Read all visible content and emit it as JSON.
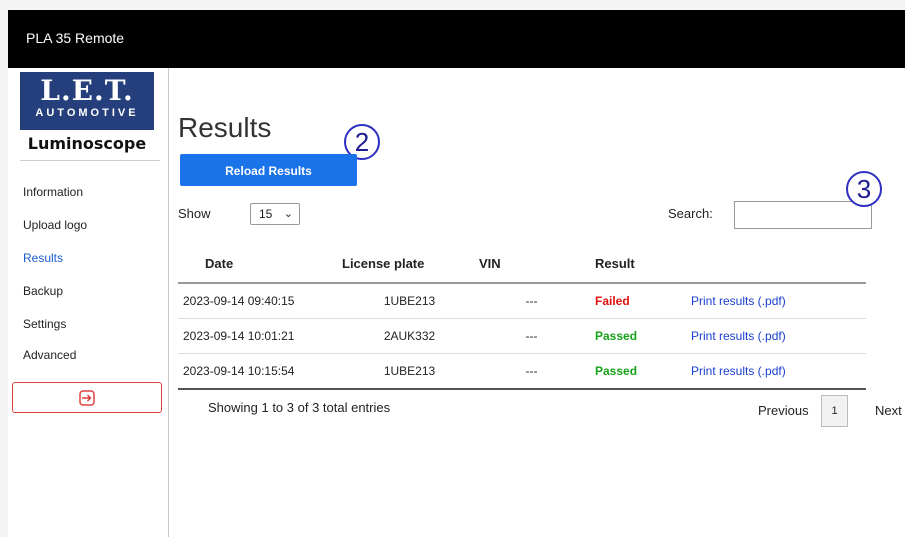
{
  "window": {
    "title": "PLA 35 Remote"
  },
  "logo": {
    "brand": "L.E.T.",
    "tagline": "AUTOMOTIVE",
    "product": "Luminoscope"
  },
  "sidebar": {
    "items": [
      {
        "label": "Information"
      },
      {
        "label": "Upload logo"
      },
      {
        "label": "Results",
        "active": true
      },
      {
        "label": "Backup"
      },
      {
        "label": "Settings"
      },
      {
        "label": "Advanced"
      }
    ],
    "logout_icon": "logout-arrow-icon"
  },
  "main": {
    "title": "Results",
    "reload_label": "Reload Results",
    "callouts": [
      "2",
      "3"
    ],
    "show_label": "Show",
    "page_size": "15",
    "search_label": "Search:",
    "search_value": ""
  },
  "table": {
    "headers": [
      "Date",
      "License plate",
      "VIN",
      "Result",
      ""
    ],
    "rows": [
      {
        "date": "2023-09-14 09:40:15",
        "plate": "1UBE213",
        "vin": "---",
        "result": "Failed",
        "action": "Print results (.pdf)"
      },
      {
        "date": "2023-09-14 10:01:21",
        "plate": "2AUK332",
        "vin": "---",
        "result": "Passed",
        "action": "Print results (.pdf)"
      },
      {
        "date": "2023-09-14 10:15:54",
        "plate": "1UBE213",
        "vin": "---",
        "result": "Passed",
        "action": "Print results (.pdf)"
      }
    ]
  },
  "pagination": {
    "summary": "Showing 1 to 3 of 3 total entries",
    "previous": "Previous",
    "current_page": "1",
    "next": "Next"
  },
  "colors": {
    "titlebar": "#000000",
    "accent": "#1a73e8",
    "failed": "#e01010",
    "passed": "#17a217",
    "link": "#1a3fd1",
    "logo_blue": "#253f7c"
  }
}
